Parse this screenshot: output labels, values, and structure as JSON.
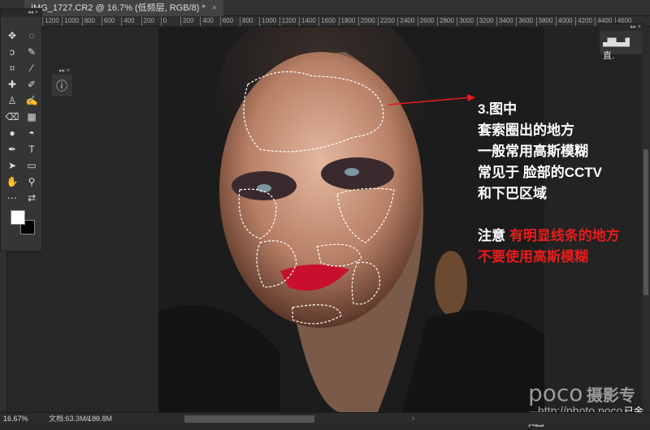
{
  "document_tab": {
    "title": "IMG_1727.CR2 @ 16.7% (低频层, RGB/8) *",
    "close": "×"
  },
  "ruler_labels": [
    "1200",
    "1000",
    "800",
    "600",
    "400",
    "200",
    "0",
    "200",
    "400",
    "600",
    "800",
    "1000",
    "1200",
    "1400",
    "1600",
    "1800",
    "2000",
    "2200",
    "2400",
    "2600",
    "2800",
    "3000",
    "3200",
    "3400",
    "3600",
    "3800",
    "4000",
    "4200",
    "4400",
    "4600"
  ],
  "toolbox": {
    "collapse": "◂◂ ×",
    "tools": [
      {
        "name": "move-tool",
        "glyph": "✥"
      },
      {
        "name": "marquee-tool",
        "glyph": "◌"
      },
      {
        "name": "lasso-tool",
        "glyph": "ↄ"
      },
      {
        "name": "quick-select-tool",
        "glyph": "✎"
      },
      {
        "name": "crop-tool",
        "glyph": "⌗"
      },
      {
        "name": "eyedropper-tool",
        "glyph": "⁄"
      },
      {
        "name": "healing-tool",
        "glyph": "✚"
      },
      {
        "name": "brush-tool",
        "glyph": "✐"
      },
      {
        "name": "stamp-tool",
        "glyph": "♙"
      },
      {
        "name": "history-brush-tool",
        "glyph": "✍"
      },
      {
        "name": "eraser-tool",
        "glyph": "⌫"
      },
      {
        "name": "gradient-tool",
        "glyph": "▦"
      },
      {
        "name": "blur-tool",
        "glyph": "●"
      },
      {
        "name": "dodge-tool",
        "glyph": "◓"
      },
      {
        "name": "pen-tool",
        "glyph": "✒"
      },
      {
        "name": "type-tool",
        "glyph": "T"
      },
      {
        "name": "path-select-tool",
        "glyph": "➤"
      },
      {
        "name": "shape-tool",
        "glyph": "▭"
      },
      {
        "name": "hand-tool",
        "glyph": "✋"
      },
      {
        "name": "zoom-tool",
        "glyph": "⚲"
      },
      {
        "name": "more-tools",
        "glyph": "⋯"
      },
      {
        "name": "swap-colors",
        "glyph": "⇄"
      }
    ]
  },
  "mini_panel": {
    "collapse": "▸▸ ×",
    "icon": "ⓘ"
  },
  "right_panel": {
    "collapse": "▸▸ ×",
    "histogram": "▟▙▟",
    "label": "直."
  },
  "annotation": {
    "lines": [
      "3.图中",
      "套索圈出的地方",
      "一般常用高斯模糊",
      "常见于 脸部的CCTV",
      "和下巴区域"
    ],
    "warning_prefix": "注意 ",
    "warning_red_1": "有明显线条的地方",
    "warning_red_2": "不要使用高斯模糊"
  },
  "colors": {
    "red": "#e81b1b",
    "foreground": "#ffffff",
    "background": "#000000"
  },
  "watermark": {
    "logo": "poco",
    "title": "摄影专题",
    "url": "http://photo.poco.cn/",
    "stamp": "已金"
  },
  "status": {
    "zoom": "16.67%",
    "doc": "文档:63.3M/189.8M",
    "arrow": "›",
    "left": "‹",
    "right": "›"
  }
}
